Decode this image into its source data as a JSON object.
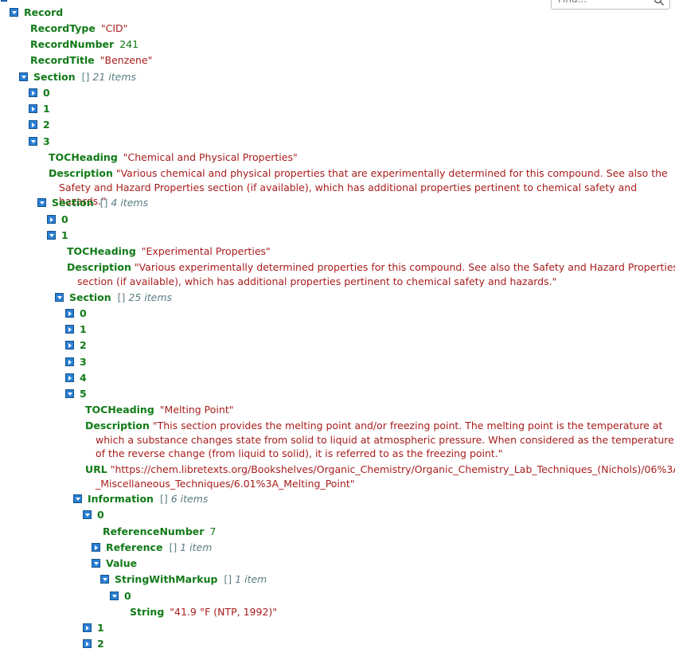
{
  "search": {
    "placeholder": "Find..."
  },
  "rows": {
    "record": "Record",
    "record_type_key": "RecordType",
    "record_type_val": "\"CID\"",
    "record_number_key": "RecordNumber",
    "record_number_val": "241",
    "record_title_key": "RecordTitle",
    "record_title_val": "\"Benzene\"",
    "section_key": "Section",
    "section_meta": "21 items",
    "s_0": "0",
    "s_1": "1",
    "s_2": "2",
    "s_3": "3",
    "s3_toc_key": "TOCHeading",
    "s3_toc_val": "\"Chemical and Physical Properties\"",
    "s3_desc_key": "Description",
    "s3_desc_val": "\"Various chemical and physical properties that are experimentally determined for this compound. See also the Safety and Hazard Properties section (if available), which has additional properties pertinent to chemical safety and hazards.\"",
    "s3_section_key": "Section",
    "s3_section_meta": "4 items",
    "s3s_0": "0",
    "s3s_1": "1",
    "s31_toc_key": "TOCHeading",
    "s31_toc_val": "\"Experimental Properties\"",
    "s31_desc_key": "Description",
    "s31_desc_val": "\"Various experimentally determined properties for this compound. See also the Safety and Hazard Properties section (if available), which has additional properties pertinent to chemical safety and hazards.\"",
    "s31_section_key": "Section",
    "s31_section_meta": "25 items",
    "s31s_0": "0",
    "s31s_1": "1",
    "s31s_2": "2",
    "s31s_3": "3",
    "s31s_4": "4",
    "s31s_5": "5",
    "s315_toc_key": "TOCHeading",
    "s315_toc_val": "\"Melting Point\"",
    "s315_desc_key": "Description",
    "s315_desc_val": "\"This section provides the melting point and/or freezing point. The melting point is the temperature at which a substance changes state from solid to liquid at atmospheric pressure. When considered as the temperature of the reverse change (from liquid to solid), it is referred to as the freezing point.\"",
    "s315_url_key": "URL",
    "s315_url_val": "\"https://chem.libretexts.org/Bookshelves/Organic_Chemistry/Organic_Chemistry_Lab_Techniques_(Nichols)/06%3A_Miscellaneous_Techniques/6.01%3A_Melting_Point\"",
    "info_key": "Information",
    "info_meta": "6 items",
    "info_0": "0",
    "refnum_key": "ReferenceNumber",
    "refnum_val": "7",
    "reference_key": "Reference",
    "reference_meta": "1 item",
    "value_key": "Value",
    "swm_key": "StringWithMarkup",
    "swm_meta": "1 item",
    "swm_0": "0",
    "string_key": "String",
    "string_val": "\"41.9 °F (NTP, 1992)\"",
    "info_1": "1",
    "info_2": "2"
  },
  "bracket": "[]",
  "icons": {
    "find": "magnifier-icon",
    "toggle_open": "caret-down",
    "toggle_closed": "caret-right"
  },
  "colors": {
    "key": "#117a17",
    "string": "#a81c1c",
    "meta": "#5a7d84",
    "toggle": "#2a7fd4"
  }
}
